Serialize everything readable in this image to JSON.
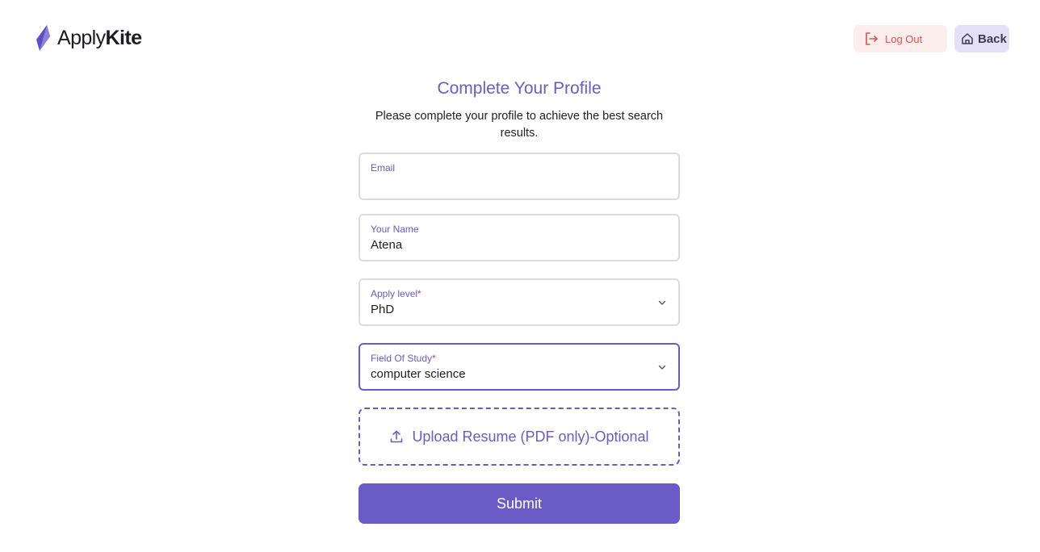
{
  "header": {
    "brand_part1": "Apply",
    "brand_part2": "Kite",
    "logo_icon": "kite-logo-icon",
    "logout_label": "Log Out",
    "logout_icon": "logout-icon",
    "back_label": "Back",
    "back_icon": "home-icon"
  },
  "form": {
    "title": "Complete Your Profile",
    "subtitle": "Please complete your profile to achieve the best search results.",
    "email": {
      "label": "Email",
      "value": ""
    },
    "name": {
      "label": "Your Name",
      "value": "Atena"
    },
    "apply_level": {
      "label": "Apply level",
      "required_mark": "*",
      "value": "PhD"
    },
    "field_of_study": {
      "label": "Field Of Study",
      "required_mark": "*",
      "value": "computer science"
    },
    "upload_label": "Upload Resume (PDF only)-Optional",
    "upload_icon": "upload-icon",
    "submit_label": "Submit"
  },
  "colors": {
    "accent": "#6a5bc7",
    "logout_text": "#e05252",
    "logout_bg": "#fdeeee",
    "back_bg": "#e4e1f6",
    "required": "#e04848"
  }
}
